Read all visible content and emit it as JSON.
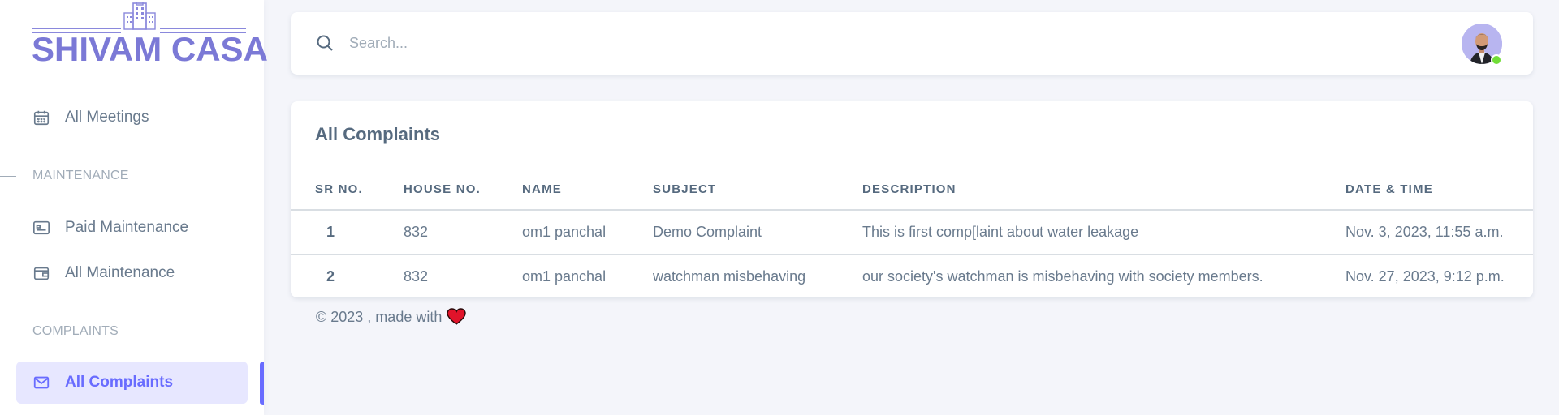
{
  "brand": {
    "name": "SHIVAM CASA"
  },
  "sidebar": {
    "items": [
      {
        "label": "All Meetings",
        "icon": "calendar-icon"
      },
      {
        "header": "MAINTENANCE"
      },
      {
        "label": "Paid Maintenance",
        "icon": "id-card-icon"
      },
      {
        "label": "All Maintenance",
        "icon": "wallet-icon"
      },
      {
        "header": "COMPLAINTS"
      },
      {
        "label": "All Complaints",
        "icon": "envelope-icon",
        "active": true
      }
    ]
  },
  "navbar": {
    "search": {
      "placeholder": "Search...",
      "value": ""
    },
    "user": {
      "status": "online"
    }
  },
  "complaints": {
    "title": "All Complaints",
    "columns": [
      "SR NO.",
      "HOUSE NO.",
      "NAME",
      "SUBJECT",
      "DESCRIPTION",
      "DATE & TIME"
    ],
    "rows": [
      [
        "1",
        "832",
        "om1 panchal",
        "Demo Complaint",
        "This is first comp[laint about water leakage",
        "Nov. 3, 2023, 11:55 a.m."
      ],
      [
        "2",
        "832",
        "om1 panchal",
        "watchman misbehaving",
        "our society's watchman is misbehaving with society members.",
        "Nov. 27, 2023, 9:12 p.m."
      ]
    ]
  },
  "footer": {
    "text": "© 2023 , made with"
  },
  "colors": {
    "accent": "#696cff",
    "brand": "#7b79d6",
    "online": "#71dd37",
    "heart": "#e0132a"
  }
}
